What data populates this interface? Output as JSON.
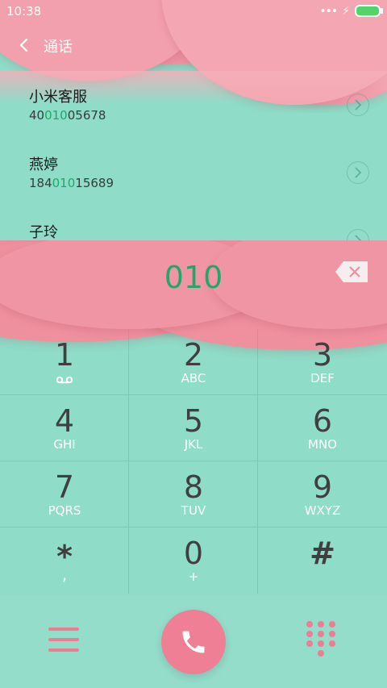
{
  "status_bar": {
    "time": "10:38",
    "dots": "•••",
    "charging": "⚡"
  },
  "header": {
    "title": "通话"
  },
  "results": [
    {
      "name": "小米客服",
      "number_pre": "40",
      "number_match": "010",
      "number_post": "05678"
    },
    {
      "name": "燕婷",
      "number_pre": "184",
      "number_match": "010",
      "number_post": "15689"
    },
    {
      "name": "子玲",
      "number_pre": "",
      "number_match": "",
      "number_post": ""
    }
  ],
  "dial": {
    "typed": "010"
  },
  "keypad": [
    {
      "digit": "1",
      "letters": ""
    },
    {
      "digit": "2",
      "letters": "ABC"
    },
    {
      "digit": "3",
      "letters": "DEF"
    },
    {
      "digit": "4",
      "letters": "GHI"
    },
    {
      "digit": "5",
      "letters": "JKL"
    },
    {
      "digit": "6",
      "letters": "MNO"
    },
    {
      "digit": "7",
      "letters": "PQRS"
    },
    {
      "digit": "8",
      "letters": "TUV"
    },
    {
      "digit": "9",
      "letters": "WXYZ"
    },
    {
      "digit": "*",
      "letters": ","
    },
    {
      "digit": "0",
      "letters": "+"
    },
    {
      "digit": "#",
      "letters": ""
    }
  ],
  "colors": {
    "pink": "#ef8e9f",
    "mint": "#8fdcc8",
    "match_green": "#1fa86a"
  },
  "icons": {
    "back": "chevron-left-icon",
    "call": "phone-icon",
    "menu": "menu-icon",
    "dialpad": "dialpad-icon",
    "backspace": "backspace-icon",
    "voicemail": "voicemail-icon"
  }
}
